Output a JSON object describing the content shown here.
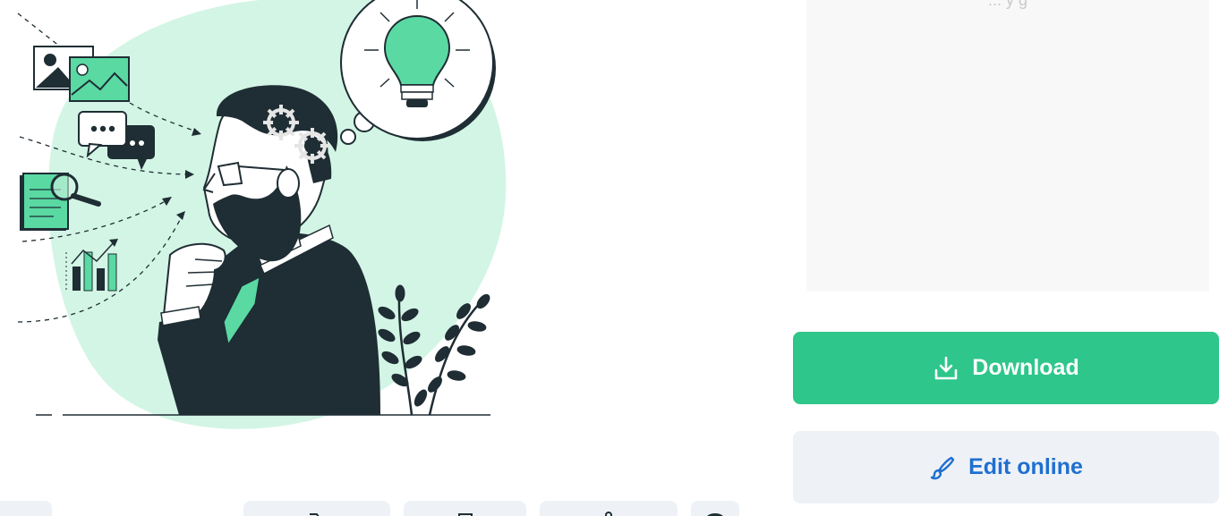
{
  "preview": {
    "partial_text": "... y   g"
  },
  "actions": {
    "download_label": "Download",
    "edit_label": "Edit online"
  },
  "icons": {
    "download": "download-icon",
    "edit": "brush-icon"
  },
  "colors": {
    "accent_green": "#2ec68a",
    "light_green": "#d3f5e5",
    "illustration_green": "#5ad9a3",
    "dark": "#1f2d34",
    "edit_blue": "#1f6fd1",
    "button_gray": "#eef2f6"
  },
  "bottom_toolbar": {
    "items": [
      "share-pill",
      "collection-icon",
      "bookmark-icon",
      "pin-icon",
      "user-icon"
    ]
  }
}
